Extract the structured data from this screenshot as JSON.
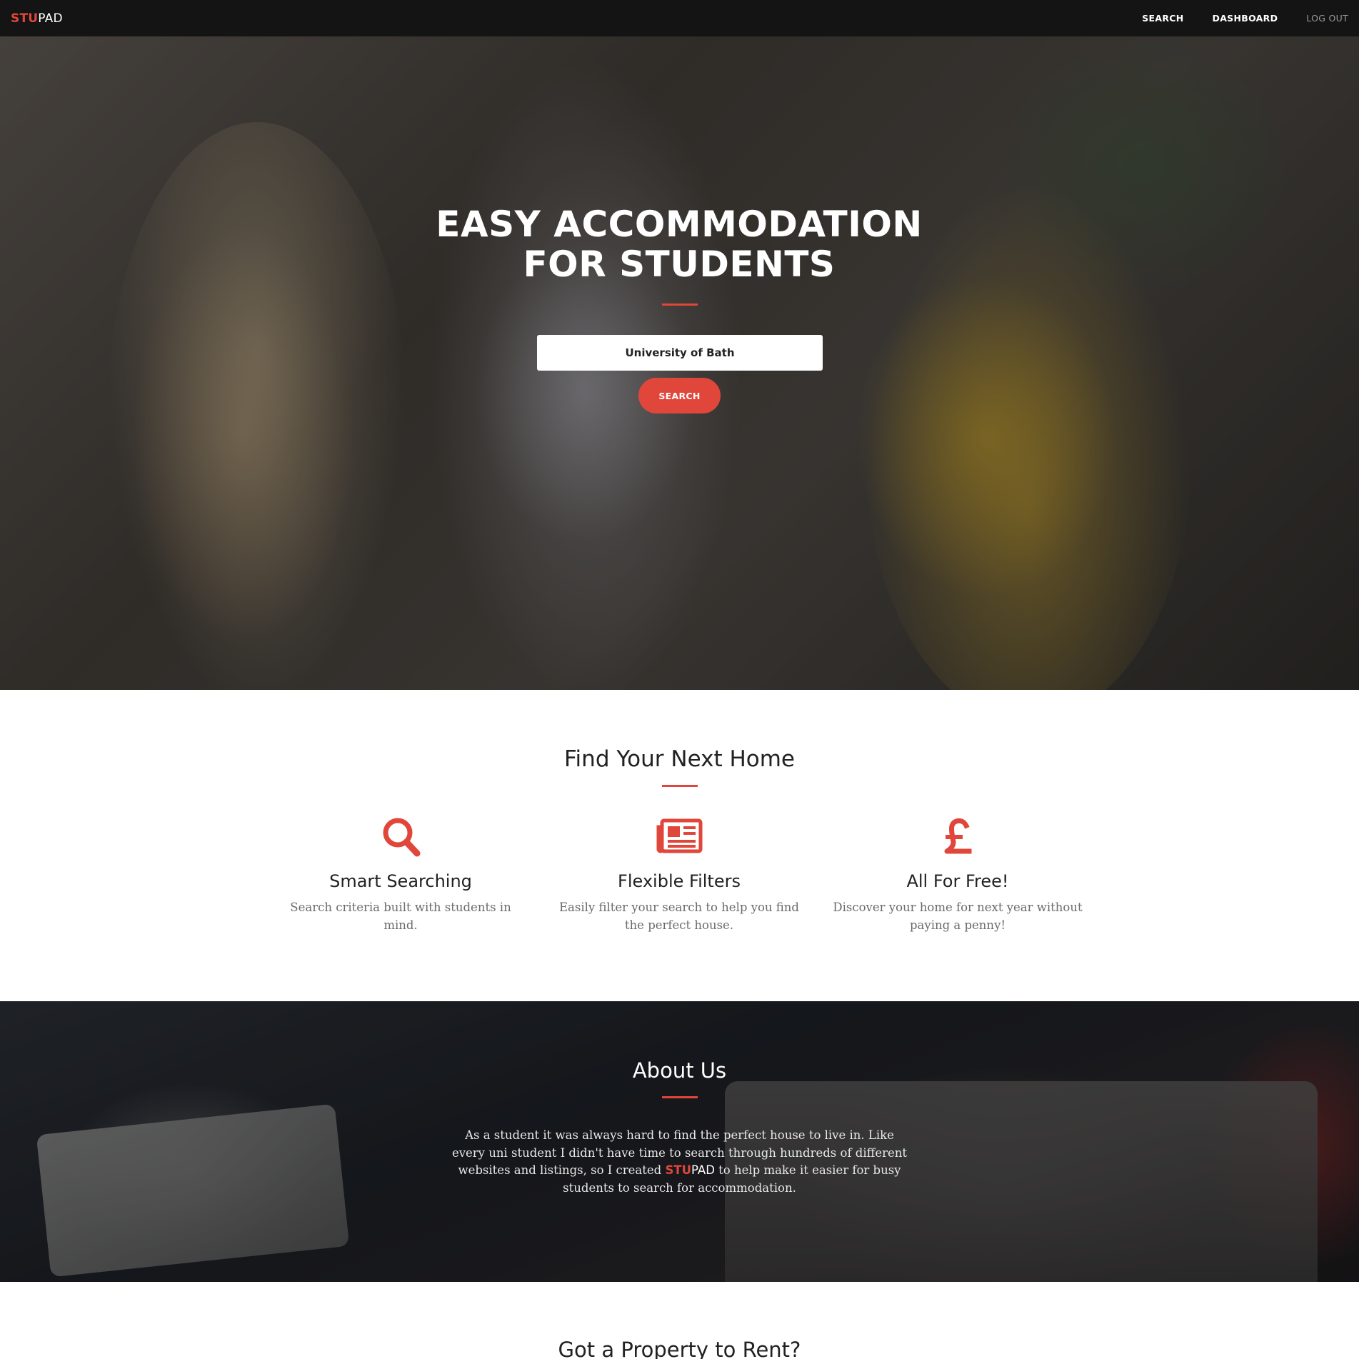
{
  "nav": {
    "brand_stu": "STU",
    "brand_pad": "PAD",
    "links": [
      "SEARCH",
      "DASHBOARD",
      "LOG OUT"
    ]
  },
  "hero": {
    "title_line1": "EASY ACCOMMODATION",
    "title_line2": "FOR STUDENTS",
    "search_value": "University of Bath",
    "search_button": "SEARCH"
  },
  "features": {
    "title": "Find Your Next Home",
    "items": [
      {
        "icon": "search-icon",
        "title": "Smart Searching",
        "text": "Search criteria built with students in mind."
      },
      {
        "icon": "newspaper-icon",
        "title": "Flexible Filters",
        "text": "Easily filter your search to help you find the perfect house."
      },
      {
        "icon": "pound-icon",
        "title": "All For Free!",
        "text": "Discover your home for next year without paying a penny!"
      }
    ]
  },
  "about": {
    "title": "About Us",
    "text_before": "As a student it was always hard to find the perfect house to live in. Like every uni student I didn't have time to search through hundreds of different websites and listings, so I created ",
    "brand_stu": "STU",
    "brand_pad": "PAD",
    "text_after": " to help make it easier for busy students to search for accommodation."
  },
  "property": {
    "title": "Got a Property to Rent?"
  },
  "colors": {
    "accent": "#e0473a",
    "navbar": "#141414"
  }
}
